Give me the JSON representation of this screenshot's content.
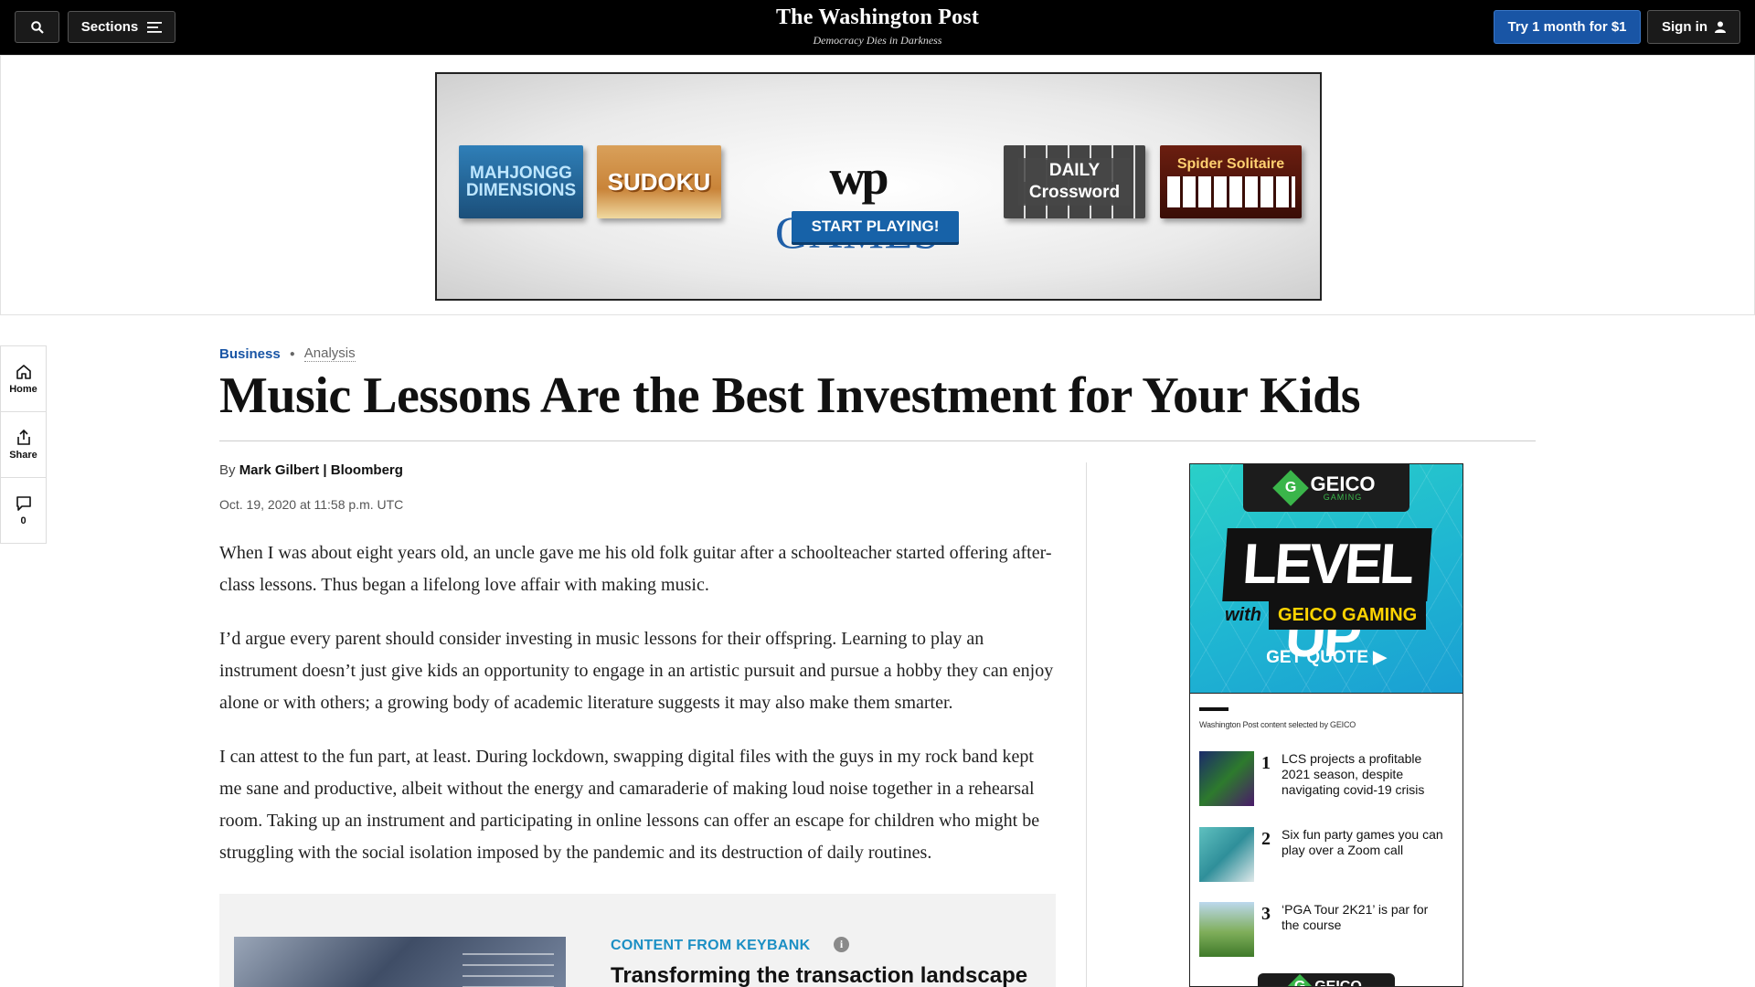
{
  "topnav": {
    "search_icon": "search-icon",
    "sections_label": "Sections",
    "sections_icon": "hamburger-menu-icon",
    "logo_text": "The Washington Post",
    "tagline": "Democracy Dies in Darkness",
    "try_label": "Try 1 month for $1",
    "signin_label": "Sign in",
    "signin_icon": "user-icon",
    "colors": {
      "bar": "#000000",
      "cta": "#1955a5"
    }
  },
  "top_ad": {
    "tiles": {
      "mahjongg": "MAHJONGG DIMENSIONS",
      "sudoku": "SUDOKU",
      "daily": [
        "DAILY",
        "Crossword"
      ],
      "spider": "Spider Solitaire"
    },
    "brand_wp": "wp",
    "brand_games": "GAMES",
    "cta": "START PLAYING!"
  },
  "left_rail": {
    "home_label": "Home",
    "share_label": "Share",
    "comments_count": "0"
  },
  "article": {
    "section": "Business",
    "label": "Analysis",
    "headline": "Music Lessons Are the Best Investment for Your Kids",
    "by_prefix": "By",
    "author": "Mark Gilbert | Bloomberg",
    "date": "Oct. 19, 2020 at 11:58 p.m. UTC",
    "paragraphs": [
      "When I was about eight years old, an uncle gave me his old folk guitar after a schoolteacher started offering after-class lessons. Thus began a lifelong love affair with making music.",
      "I’d argue every parent should consider investing in music lessons for their offspring. Learning to play an instrument doesn’t just give kids an opportunity to engage in an artistic pursuit and pursue a hobby they can enjoy alone or with others; a growing body of academic literature suggests it may also make them smarter.",
      "I can attest to the fun part, at least. During lockdown, swapping digital files with the guys in my rock band kept me sane and productive, albeit without the energy and camaraderie of making loud noise together in a rehearsal room. Taking up an instrument and participating in online lessons can offer an escape for children who might be struggling with the  social isolation imposed by the pandemic and its destruction of daily routines."
    ],
    "sponsored": {
      "label": "CONTENT FROM KEYBANK",
      "info_icon": "info-icon",
      "title": "Transforming the transaction landscape"
    }
  },
  "side_ad": {
    "brand": "GEICO",
    "brand_sub": "GAMING",
    "headline": "LEVEL UP",
    "with": "with",
    "with_brand": "GEICO GAMING",
    "cta": "GET QUOTE ▶",
    "note": "Washington Post content selected by GEICO",
    "items": [
      {
        "num": "1",
        "text": "LCS projects a profitable 2021 season, despite navigating covid-19 crisis"
      },
      {
        "num": "2",
        "text": "Six fun party games you can play over a Zoom call"
      },
      {
        "num": "3",
        "text": "‘PGA Tour 2K21’ is par for the course"
      }
    ],
    "colors": {
      "teal": "#1fb6d2",
      "green": "#3ab54a",
      "yellow": "#ffd400"
    }
  }
}
